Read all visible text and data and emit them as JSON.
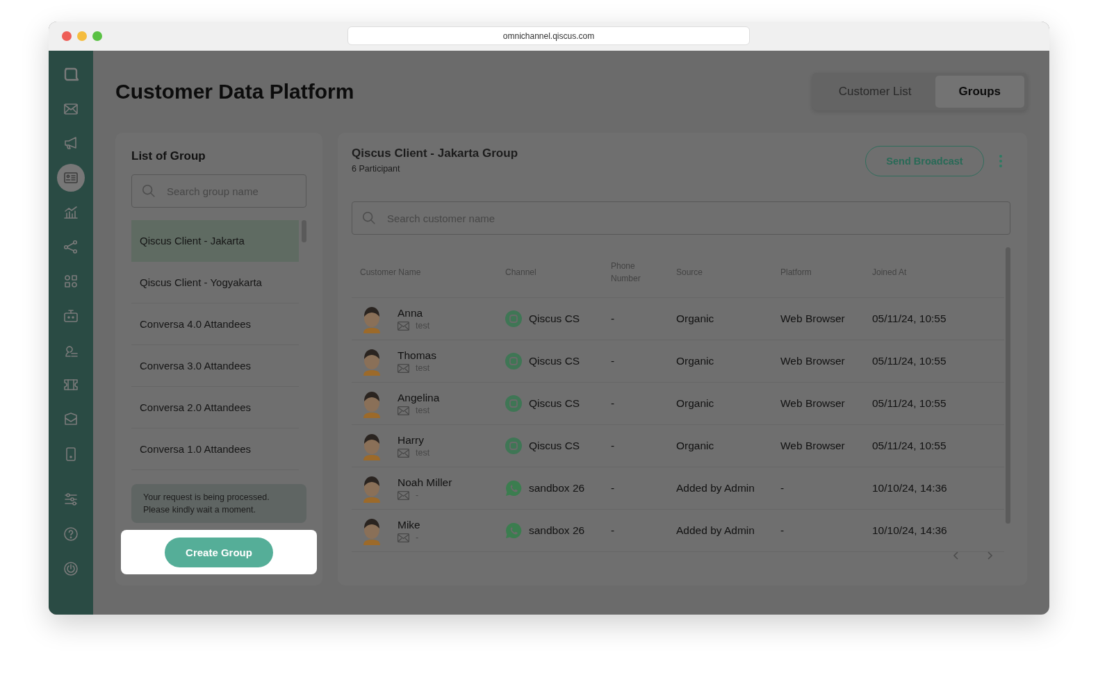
{
  "window": {
    "url": "omnichannel.qiscus.com"
  },
  "sidebar": {
    "items": [
      {
        "selected": false
      },
      {
        "selected": false
      },
      {
        "selected": false
      },
      {
        "selected": true
      },
      {
        "selected": false
      },
      {
        "selected": false
      },
      {
        "selected": false
      },
      {
        "selected": false
      },
      {
        "selected": false
      },
      {
        "selected": false
      },
      {
        "selected": false
      },
      {
        "selected": false
      }
    ],
    "bottom_items": [
      {
        "selected": false
      },
      {
        "selected": false
      },
      {
        "selected": false
      }
    ]
  },
  "header": {
    "title": "Customer Data Platform",
    "tabs": [
      {
        "label": "Customer List",
        "selected": false
      },
      {
        "label": "Groups",
        "selected": true
      }
    ]
  },
  "groups": {
    "title": "List of Group",
    "search": {
      "placeholder": "Search group name"
    },
    "items": [
      {
        "label": "Qiscus Client - Jakarta",
        "selected": true
      },
      {
        "label": "Qiscus Client - Yogyakarta",
        "selected": false
      },
      {
        "label": "Conversa 4.0 Attandees",
        "selected": false
      },
      {
        "label": "Conversa 3.0 Attandees",
        "selected": false
      },
      {
        "label": "Conversa 2.0 Attandees",
        "selected": false
      },
      {
        "label": "Conversa 1.0 Attandees",
        "selected": false
      }
    ],
    "notice": "Your request is being processed. Please kindly wait a moment.",
    "create_button": "Create Group"
  },
  "detail": {
    "title": "Qiscus Client - Jakarta Group",
    "subtitle": "6 Participant",
    "send_button": "Send Broadcast",
    "search": {
      "placeholder": "Search customer name"
    },
    "columns": [
      "Customer Name",
      "Channel",
      "Phone Number",
      "Source",
      "Platform",
      "Joined At"
    ],
    "rows": [
      {
        "name": "Anna",
        "email": "test",
        "kind": "qiscus",
        "channel": "Qiscus CS",
        "phone": "-",
        "source": "Organic",
        "platform": "Web Browser",
        "joined": "05/11/24, 10:55"
      },
      {
        "name": "Thomas",
        "email": "test",
        "kind": "qiscus",
        "channel": "Qiscus CS",
        "phone": "-",
        "source": "Organic",
        "platform": "Web Browser",
        "joined": "05/11/24, 10:55"
      },
      {
        "name": "Angelina",
        "email": "test",
        "kind": "qiscus",
        "channel": "Qiscus CS",
        "phone": "-",
        "source": "Organic",
        "platform": "Web Browser",
        "joined": "05/11/24, 10:55"
      },
      {
        "name": "Harry",
        "email": "test",
        "kind": "qiscus",
        "channel": "Qiscus CS",
        "phone": "-",
        "source": "Organic",
        "platform": "Web Browser",
        "joined": "05/11/24, 10:55"
      },
      {
        "name": "Noah Miller",
        "email": "-",
        "kind": "whatsapp",
        "channel": "sandbox 26",
        "phone": "-",
        "source": "Added by Admin",
        "platform": "-",
        "joined": "10/10/24, 14:36"
      },
      {
        "name": "Mike",
        "email": "-",
        "kind": "whatsapp",
        "channel": "sandbox 26",
        "phone": "-",
        "source": "Added by Admin",
        "platform": "-",
        "joined": "10/10/24, 14:36"
      }
    ]
  }
}
